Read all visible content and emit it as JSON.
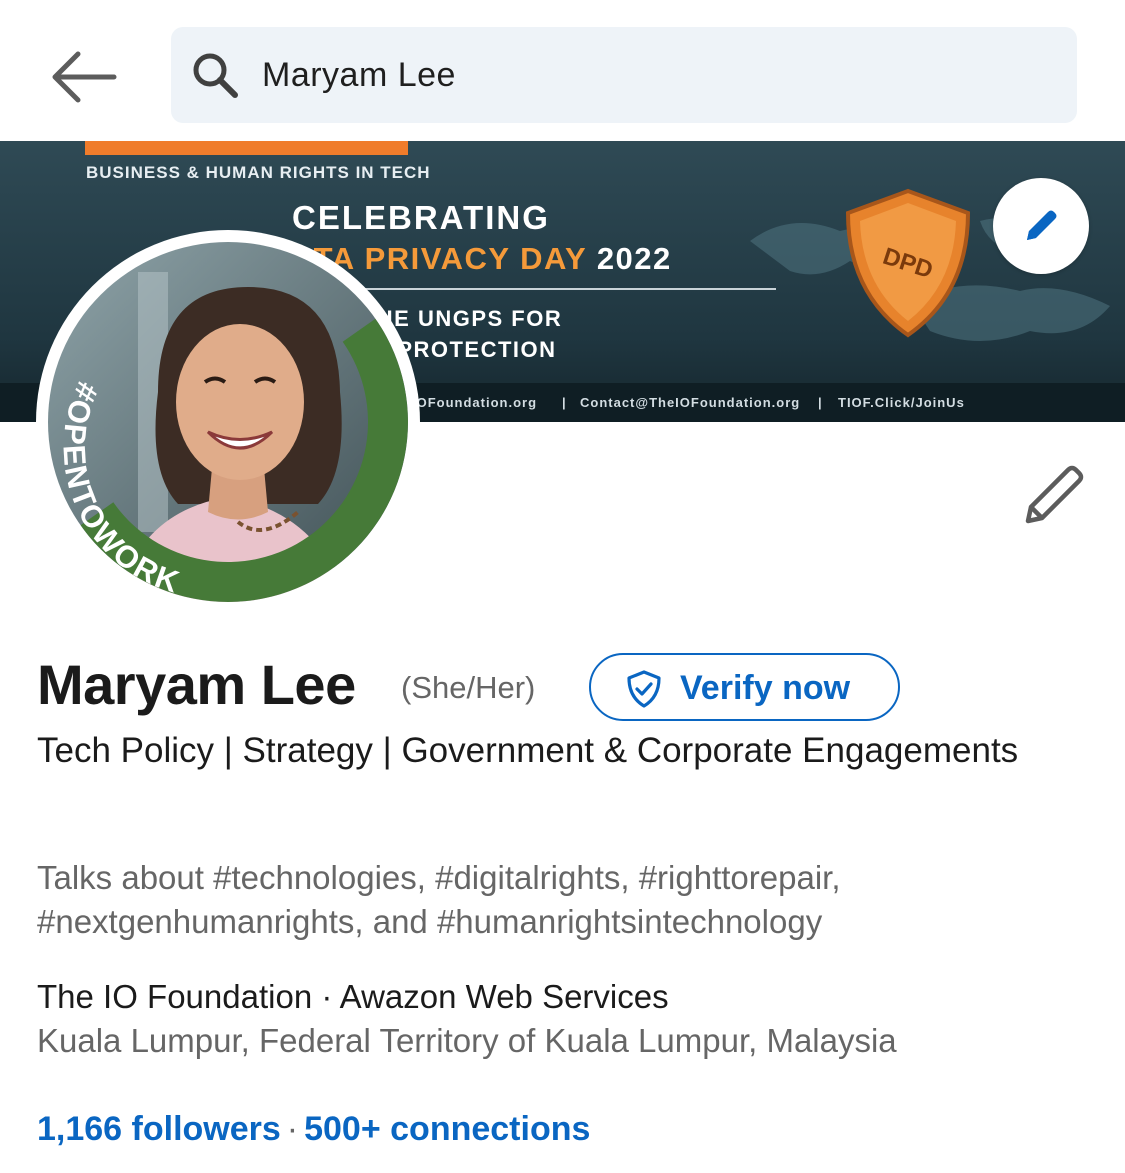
{
  "search": {
    "query": "Maryam Lee"
  },
  "banner": {
    "supertitle": "BUSINESS & HUMAN RIGHTS IN TECH",
    "title_line1": "CELEBRATING",
    "title_line2": "ATA PRIVACY DAY",
    "title_year": "2022",
    "subtitle_line1": "GING THE UNGPS FOR",
    "subtitle_line2": "IVACY & PROTECTION",
    "footer_1": "IOFoundation.org",
    "footer_2": "Contact@TheIOFoundation.org",
    "footer_3": "TIOF.Click/JoinUs",
    "footer_sep": "|",
    "shield_text": "DPD"
  },
  "avatar": {
    "frame_text": "#OPENTOWORK",
    "frame_color": "#467a38"
  },
  "profile": {
    "name": "Maryam Lee",
    "pronouns": "(She/Her)",
    "verify_label": "Verify now",
    "headline": "Tech Policy | Strategy | Government & Corporate Engagements",
    "talks_about": "Talks about #technologies, #digitalrights, #righttorepair, #nextgenhumanrights, and #humanrightsintechnology",
    "company": "The IO Foundation · Awazon Web Services",
    "location": "Kuala Lumpur, Federal Territory of Kuala Lumpur, Malaysia",
    "followers": "1,166 followers",
    "separator": "·",
    "connections": "500+ connections"
  },
  "colors": {
    "accent": "#0a66c2",
    "search_bg": "#eef3f8",
    "banner_orange": "#f07c2b"
  }
}
